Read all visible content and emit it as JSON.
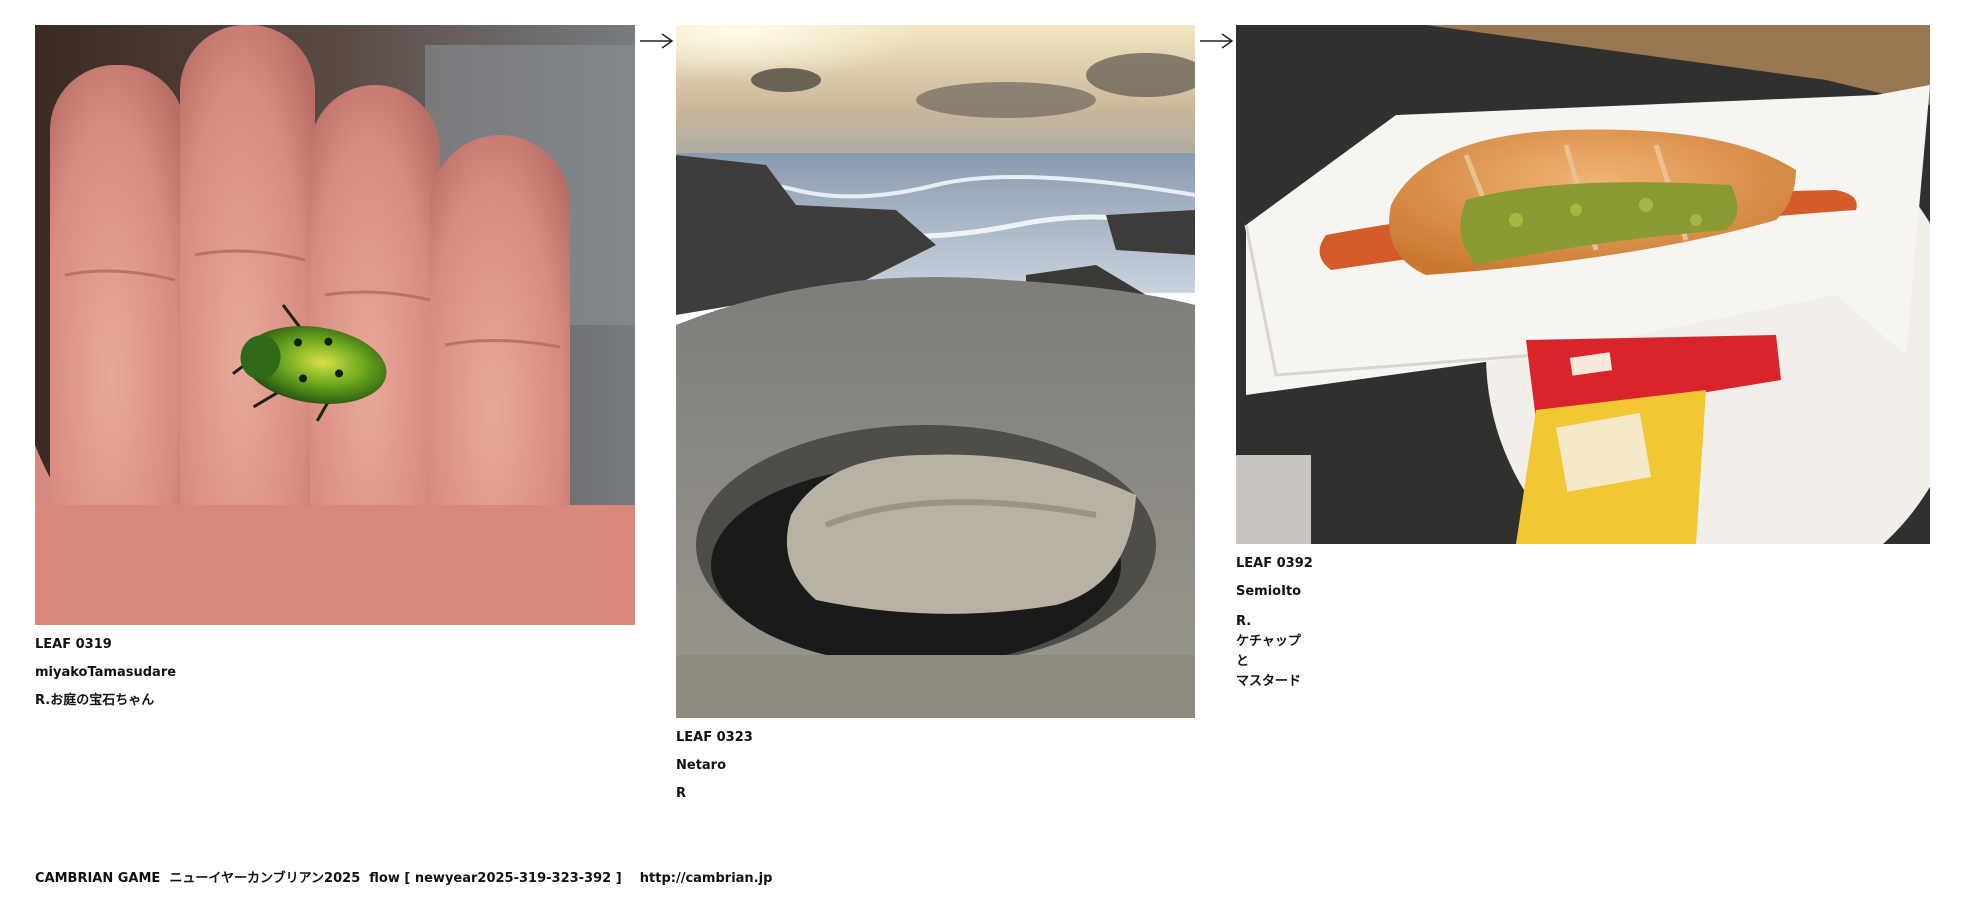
{
  "leaves": [
    {
      "id": "LEAF 0319",
      "author": "miyakoTamasudare",
      "comment": "R.お庭の宝石ちゃん",
      "image": "jewel-beetle-on-hand-photo"
    },
    {
      "id": "LEAF 0323",
      "author": "Netaro",
      "comment": "R",
      "image": "rocky-seashore-photo"
    },
    {
      "id": "LEAF 0392",
      "author": "SemioIto",
      "comment_lines": [
        "R.",
        "ケチャップ",
        "と",
        "マスタード"
      ],
      "image": "hotdog-ketchup-mustard-photo"
    }
  ],
  "arrows": [
    "right-arrow-icon",
    "right-arrow-icon"
  ],
  "footer": {
    "text": "CAMBRIAN GAME  ニューイヤーカンブリアン2025  flow [ newyear2025-319-323-392 ]    http://cambrian.jp"
  }
}
